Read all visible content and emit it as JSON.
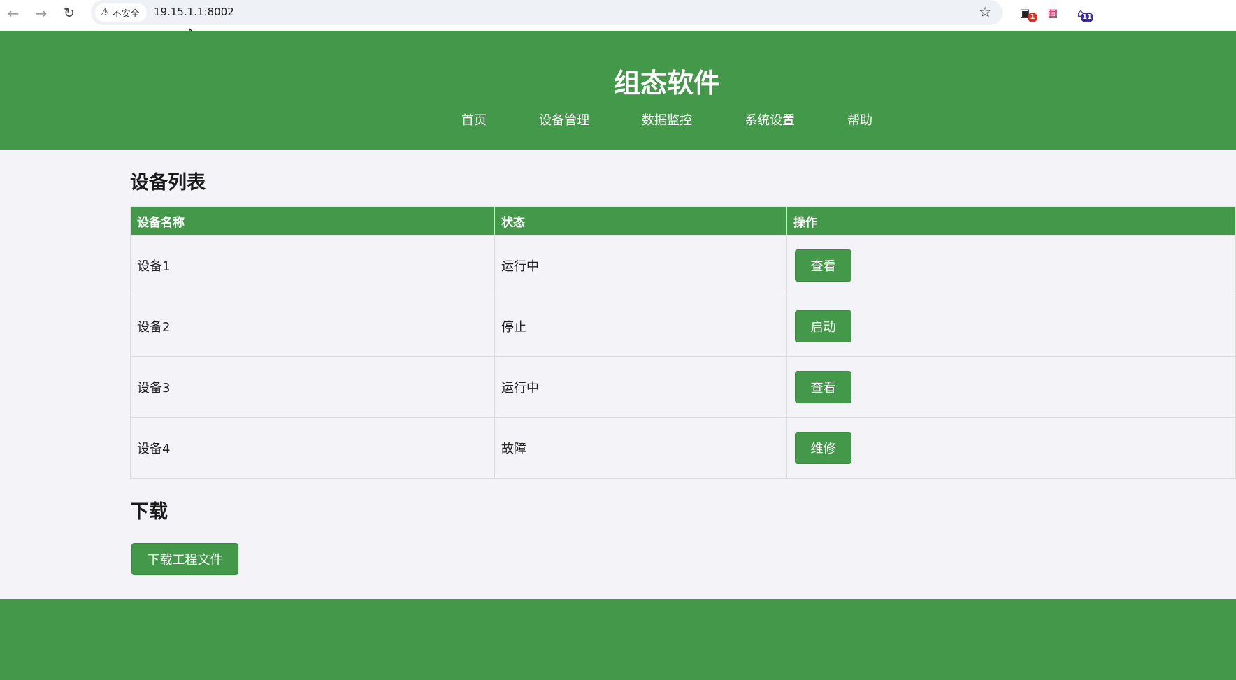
{
  "browser": {
    "security_label": "不安全",
    "url": "19.15.1.1:8002",
    "extensions": [
      {
        "name": "extension-1",
        "badge": "1"
      },
      {
        "name": "translate-extension",
        "badge": ""
      },
      {
        "name": "extension-3",
        "badge": "11"
      }
    ]
  },
  "header": {
    "title": "组态软件",
    "nav": [
      "首页",
      "设备管理",
      "数据监控",
      "系统设置",
      "帮助"
    ]
  },
  "device_list": {
    "title": "设备列表",
    "columns": [
      "设备名称",
      "状态",
      "操作"
    ],
    "rows": [
      {
        "name": "设备1",
        "status": "运行中",
        "action": "查看"
      },
      {
        "name": "设备2",
        "status": "停止",
        "action": "启动"
      },
      {
        "name": "设备3",
        "status": "运行中",
        "action": "查看"
      },
      {
        "name": "设备4",
        "status": "故障",
        "action": "维修"
      }
    ]
  },
  "download": {
    "title": "下载",
    "button_label": "下载工程文件"
  },
  "colors": {
    "primary_green": "#43984a",
    "page_background": "#f3f3f8"
  }
}
